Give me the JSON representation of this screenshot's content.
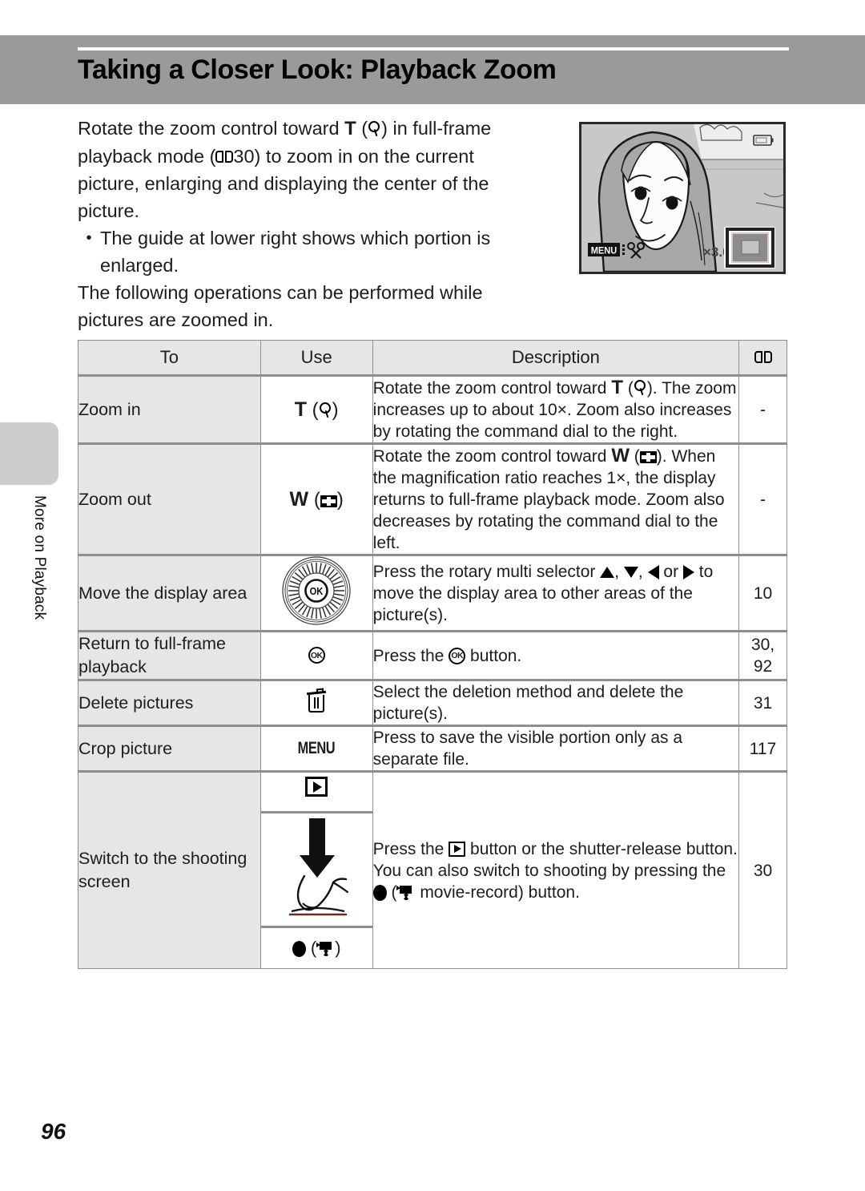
{
  "page": {
    "title": "Taking a Closer Look: Playback Zoom",
    "number": "96",
    "side_tab": "More on Playback"
  },
  "intro": {
    "line1_a": "Rotate the zoom control toward ",
    "line1_t": "T",
    "line1_b": " (",
    "line1_c": ") in full-frame",
    "line2_a": "playback mode (",
    "line2_ref": "30) to zoom in on the current",
    "line3": "picture, enlarging and displaying the center of the",
    "line4": "picture.",
    "bullet_dot": "•",
    "bullet": "The guide at lower right shows which portion is enlarged.",
    "closing": "The following operations can be performed while pictures are zoomed in."
  },
  "illustration": {
    "menu_badge": "MENU",
    "crop_icon": "scissors-icon",
    "magnification": "×3.0",
    "guide_label": "zoom-guide-box",
    "battery_label": "battery-icon"
  },
  "table": {
    "headers": {
      "to": "To",
      "use": "Use",
      "description": "Description",
      "reference": "book-icon"
    },
    "rows": [
      {
        "to": "Zoom in",
        "use_label": "T",
        "use_icon": "magnify-icon",
        "desc_a": "Rotate the zoom control toward ",
        "desc_t": "T",
        "desc_b": " (",
        "desc_c": "). The zoom increases up to about 10×. Zoom also increases by rotating the command dial to the right.",
        "ref": "-"
      },
      {
        "to": "Zoom out",
        "use_label": "W",
        "use_icon": "thumbnail-icon",
        "desc_a": "Rotate the zoom control toward ",
        "desc_t": "W",
        "desc_b": " (",
        "desc_c": "). When the magnification ratio reaches 1×, the display returns to full-frame playback mode. Zoom also decreases by rotating the command dial to the left.",
        "ref": "-"
      },
      {
        "to": "Move the display area",
        "use_icon": "rotary-multi-selector-icon",
        "desc_a": "Press the rotary multi selector ",
        "desc_b": ", ",
        "desc_c": ", ",
        "desc_d": " or ",
        "desc_e": " to move the display area to other areas of the picture(s).",
        "ref": "10"
      },
      {
        "to": "Return to full-frame playback",
        "use_icon": "ok-button-icon",
        "desc_a": "Press the ",
        "desc_b": " button.",
        "ref": "30,\n92"
      },
      {
        "to": "Delete pictures",
        "use_icon": "trash-icon",
        "desc_a": "Select the deletion method and delete the picture(s).",
        "ref": "31"
      },
      {
        "to": "Crop picture",
        "use_label": "MENU",
        "use_icon": "menu-button-icon",
        "desc_a": "Press to save the visible portion only as a separate file.",
        "ref": "117"
      },
      {
        "to": "Switch to the shooting screen",
        "use_icons": [
          "playback-button-icon",
          "shutter-release-press-icon",
          "movie-record-button-icon"
        ],
        "desc_a": "Press the ",
        "desc_b": " button or the shutter-release button. You can also switch to shooting by pressing the ",
        "desc_c": " (",
        "desc_d": " movie-record) button.",
        "ref": "30"
      }
    ]
  }
}
